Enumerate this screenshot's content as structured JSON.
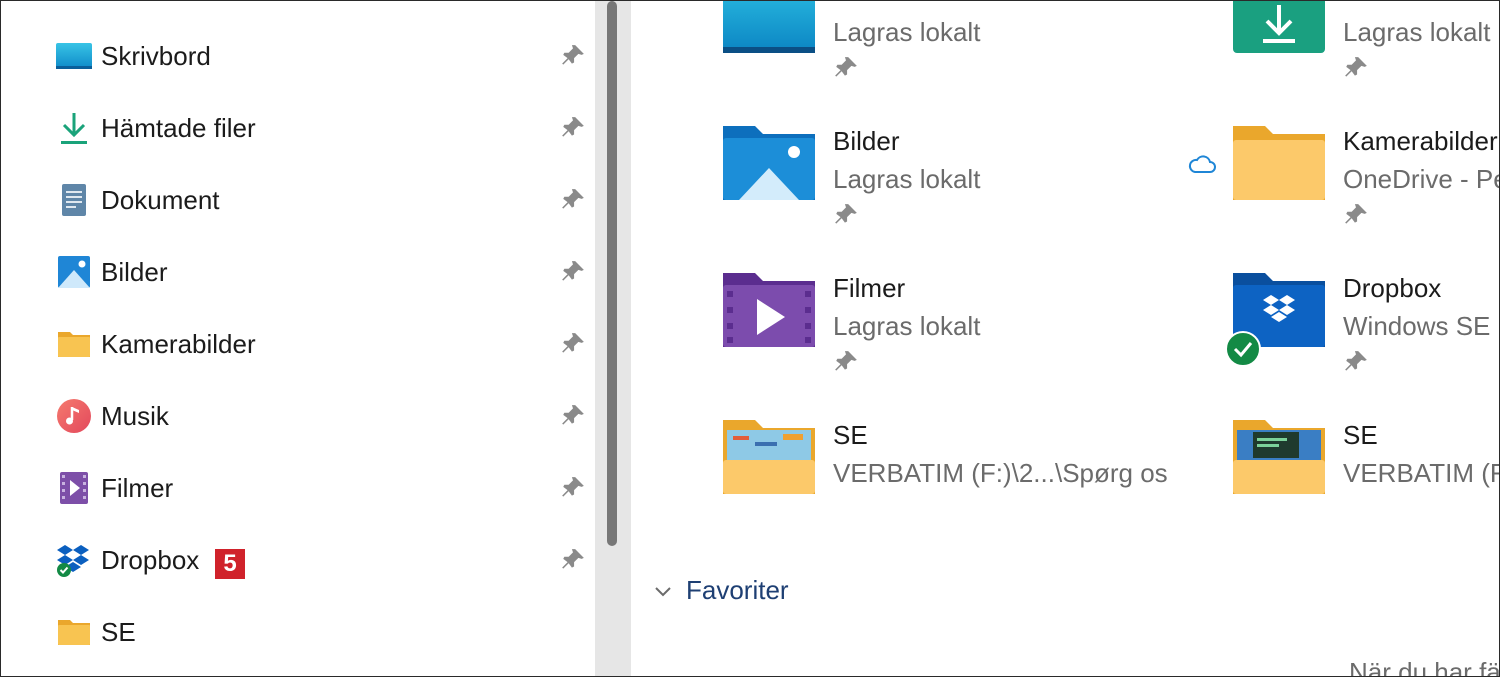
{
  "sidebar": {
    "items": [
      {
        "label": "Skrivbord",
        "icon": "desktop-icon"
      },
      {
        "label": "Hämtade filer",
        "icon": "download-icon"
      },
      {
        "label": "Dokument",
        "icon": "document-icon"
      },
      {
        "label": "Bilder",
        "icon": "pictures-icon"
      },
      {
        "label": "Kamerabilder",
        "icon": "folder-icon"
      },
      {
        "label": "Musik",
        "icon": "music-icon"
      },
      {
        "label": "Filmer",
        "icon": "video-icon"
      },
      {
        "label": "Dropbox",
        "icon": "dropbox-icon",
        "badge": "5"
      },
      {
        "label": "SE",
        "icon": "folder-icon"
      }
    ]
  },
  "quick_access": {
    "tiles": [
      {
        "name": "",
        "subtitle": "Lagras lokalt",
        "icon": "desktop-folder-icon"
      },
      {
        "name": "",
        "subtitle": "Lagras lokalt",
        "icon": "downloads-folder-icon"
      },
      {
        "name": "Bilder",
        "subtitle": "Lagras lokalt",
        "icon": "pictures-folder-icon"
      },
      {
        "name": "Kamerabilder",
        "subtitle": "OneDrive - Pe",
        "icon": "folder-icon",
        "status_icon": "cloud-icon"
      },
      {
        "name": "Filmer",
        "subtitle": "Lagras lokalt",
        "icon": "video-folder-icon"
      },
      {
        "name": "Dropbox",
        "subtitle": "Windows SE (",
        "icon": "dropbox-folder-icon",
        "status_icon": "synced-check-icon"
      },
      {
        "name": "SE",
        "subtitle": "VERBATIM (F:)\\2...\\Spørg os",
        "icon": "folder-icon"
      },
      {
        "name": "SE",
        "subtitle": "VERBATIM (F:",
        "icon": "folder-icon"
      }
    ]
  },
  "favorites": {
    "title": "Favoriter",
    "hint": "När du har fä"
  },
  "colors": {
    "accent": "#1e3f73",
    "folder": "#f6c04e",
    "badge": "#d0222b",
    "synced": "#138a45"
  }
}
